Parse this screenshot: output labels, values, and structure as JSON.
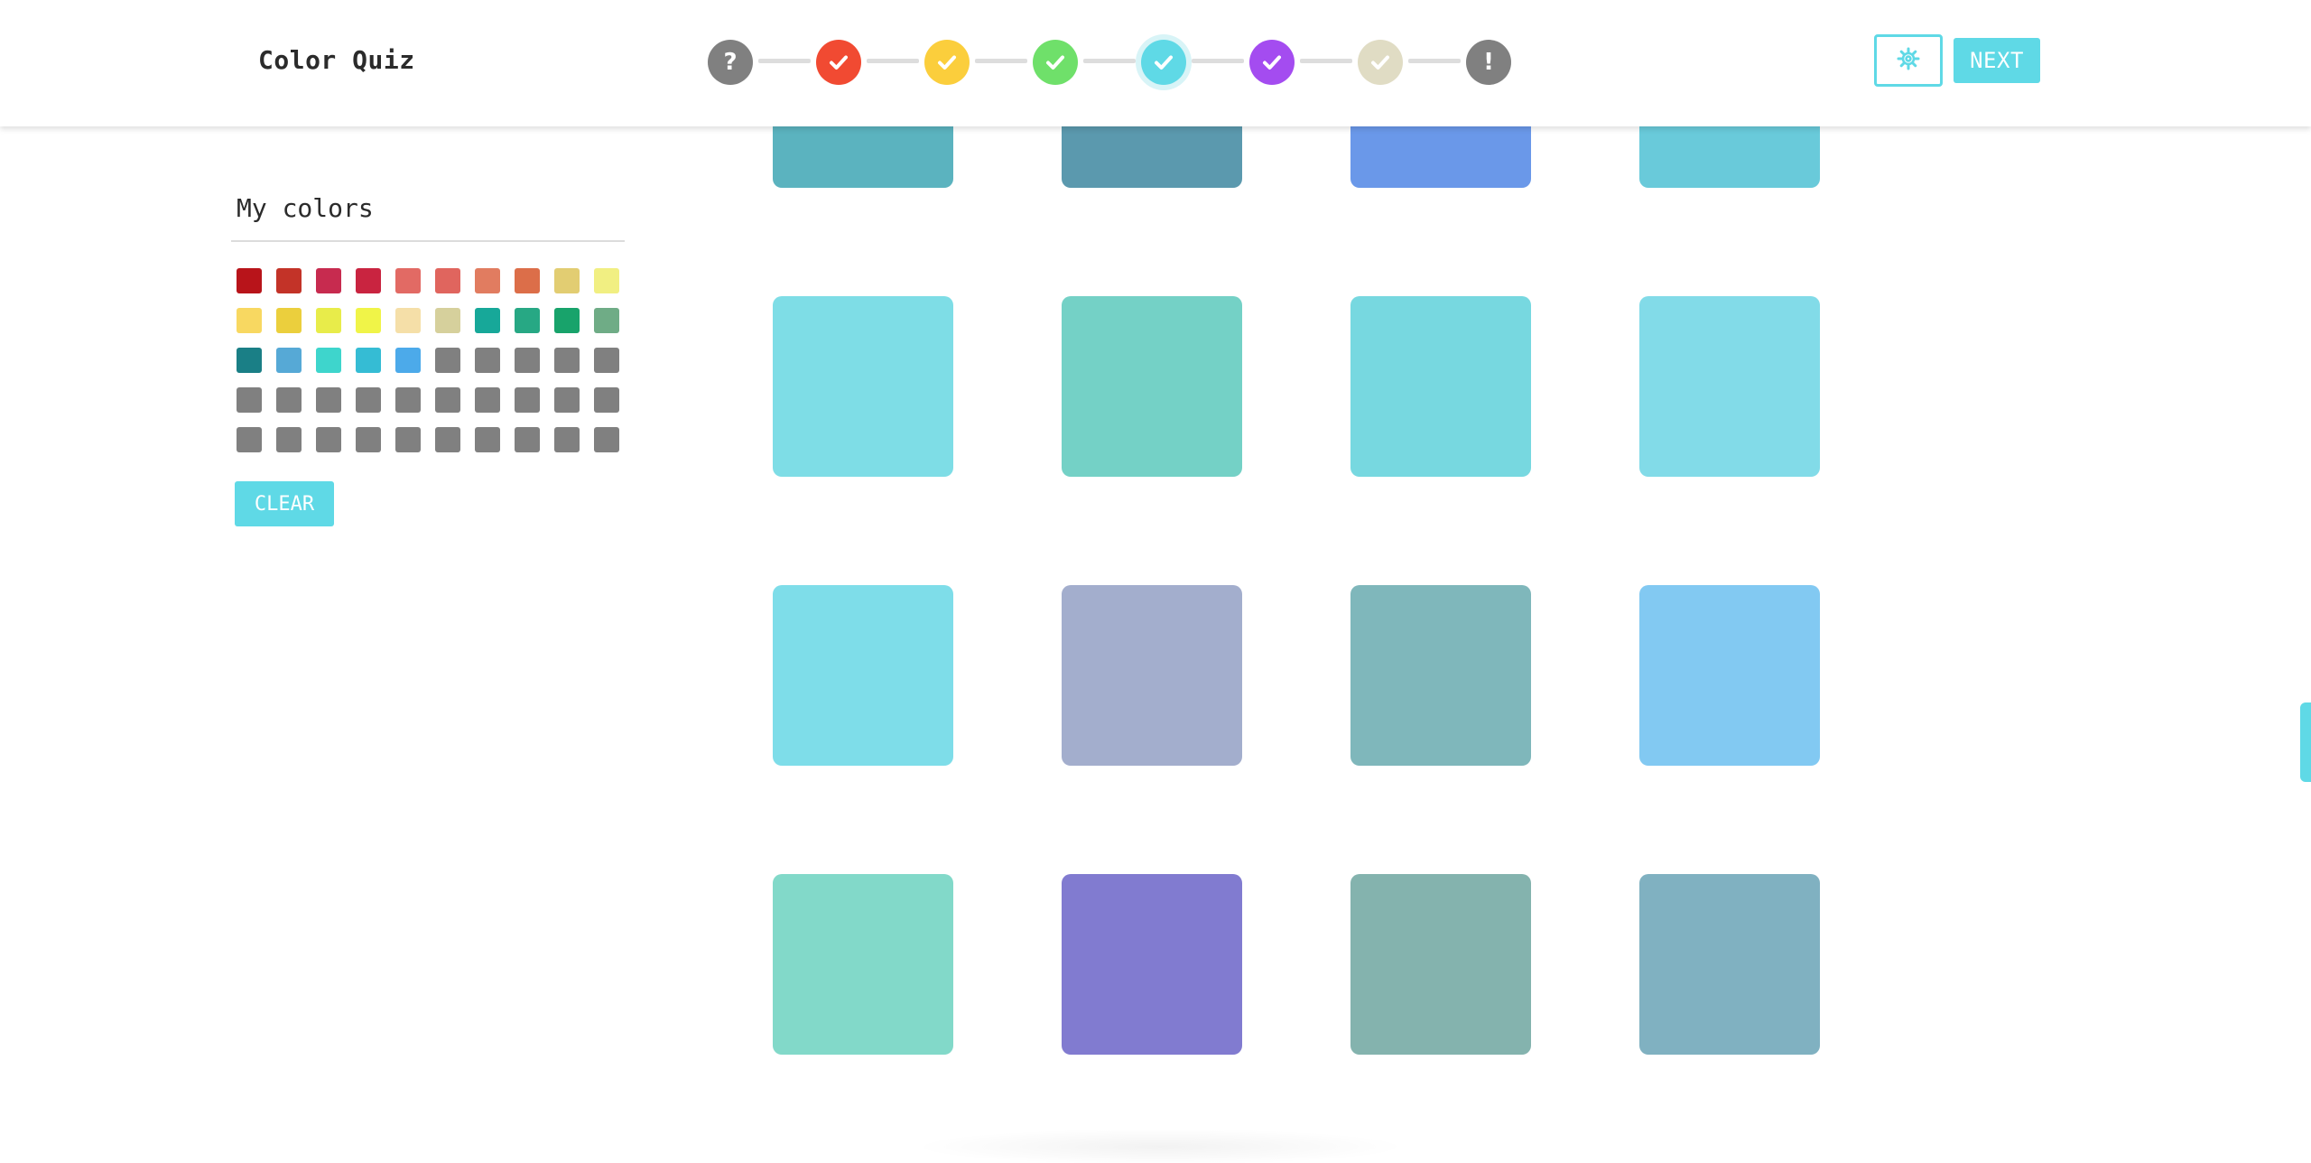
{
  "header": {
    "title": "Color Quiz",
    "settings_icon": "gear-icon",
    "next_label": "NEXT",
    "accent_color": "#5fd9e6"
  },
  "progress_steps": [
    {
      "status": "unknown",
      "icon": "question-icon",
      "glyph": "?",
      "color": "#808080"
    },
    {
      "status": "done",
      "icon": "check-icon",
      "color": "#f14a32"
    },
    {
      "status": "done",
      "icon": "check-icon",
      "color": "#fbce3c"
    },
    {
      "status": "done",
      "icon": "check-icon",
      "color": "#6fe06a"
    },
    {
      "status": "current",
      "icon": "check-icon",
      "color": "#5fd9e6"
    },
    {
      "status": "done",
      "icon": "check-icon",
      "color": "#a44cf0"
    },
    {
      "status": "done",
      "icon": "check-icon",
      "color": "#e0dcc4"
    },
    {
      "status": "final",
      "icon": "exclamation-icon",
      "glyph": "!",
      "color": "#808080"
    }
  ],
  "sidebar": {
    "title": "My colors",
    "clear_label": "CLEAR",
    "swatches": [
      "#b8141a",
      "#c33328",
      "#c72b4f",
      "#c92440",
      "#e26a64",
      "#e0655e",
      "#e17c60",
      "#dc6e49",
      "#e2cd72",
      "#f1ef82",
      "#f8d861",
      "#ebcf3d",
      "#e8ec4a",
      "#f0f448",
      "#f5dfa8",
      "#d6d09c",
      "#17a899",
      "#27a884",
      "#18a36b",
      "#6fac86",
      "#1a7f86",
      "#56a9d6",
      "#3ed5cc",
      "#35bcd4",
      "#4caaea",
      "#808080",
      "#808080",
      "#808080",
      "#808080",
      "#808080",
      "#808080",
      "#808080",
      "#808080",
      "#808080",
      "#808080",
      "#808080",
      "#808080",
      "#808080",
      "#808080",
      "#808080",
      "#808080",
      "#808080",
      "#808080",
      "#808080",
      "#808080",
      "#808080",
      "#808080",
      "#808080",
      "#808080",
      "#808080"
    ]
  },
  "color_grid": {
    "rows": [
      [
        "#5bb3bf",
        "#5b99ae",
        "#6a98e9",
        "#69cada"
      ],
      [
        "#7eddе6",
        "#74d1c6",
        "#77d8e0",
        "#82dbe8"
      ],
      [
        "#7edde9",
        "#a3aecd",
        "#7fb7bb",
        "#82c9f2"
      ],
      [
        "#82d9c9",
        "#817bd0",
        "#84b3ae",
        "#80b1c1"
      ]
    ]
  }
}
